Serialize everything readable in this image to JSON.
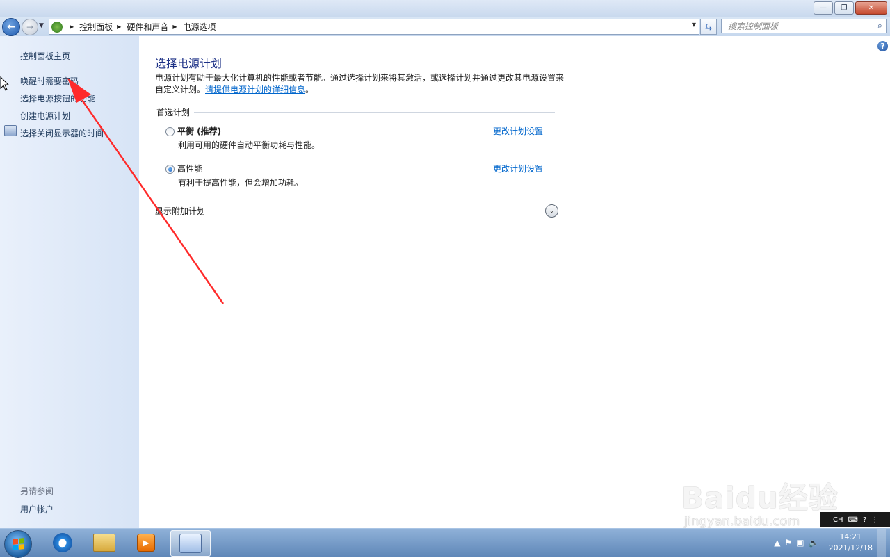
{
  "window": {
    "minimize_glyph": "—",
    "restore_glyph": "❐",
    "close_glyph": "✕"
  },
  "navigation": {
    "back_glyph": "←",
    "forward_glyph": "→",
    "breadcrumbs": [
      "控制面板",
      "硬件和声音",
      "电源选项"
    ],
    "search_placeholder": "搜索控制面板"
  },
  "sidebar": {
    "home": "控制面板主页",
    "items": [
      "唤醒时需要密码",
      "选择电源按钮的功能",
      "创建电源计划",
      "选择关闭显示器的时间"
    ],
    "see_also_title": "另请参阅",
    "see_also_items": [
      "用户帐户"
    ]
  },
  "main": {
    "title": "选择电源计划",
    "intro_text": "电源计划有助于最大化计算机的性能或者节能。通过选择计划来将其激活，或选择计划并通过更改其电源设置来自定义计划。",
    "intro_link": "请提供电源计划的详细信息",
    "intro_end": "。",
    "preferred_section": "首选计划",
    "plans": [
      {
        "name": "平衡 (推荐)",
        "desc": "利用可用的硬件自动平衡功耗与性能。",
        "link": "更改计划设置",
        "selected": false
      },
      {
        "name": "高性能",
        "desc": "有利于提高性能，但会增加功耗。",
        "link": "更改计划设置",
        "selected": true
      }
    ],
    "more_plans": "显示附加计划"
  },
  "watermark": {
    "text": "Baidu经验",
    "url": "jingyan.baidu.com"
  },
  "langbar": {
    "lang": "CH"
  },
  "taskbar": {
    "time": "14:21",
    "date": "2021/12/18"
  },
  "colors": {
    "link": "#0066cc",
    "title": "#1e3287",
    "arrow": "#ff2a2a"
  }
}
